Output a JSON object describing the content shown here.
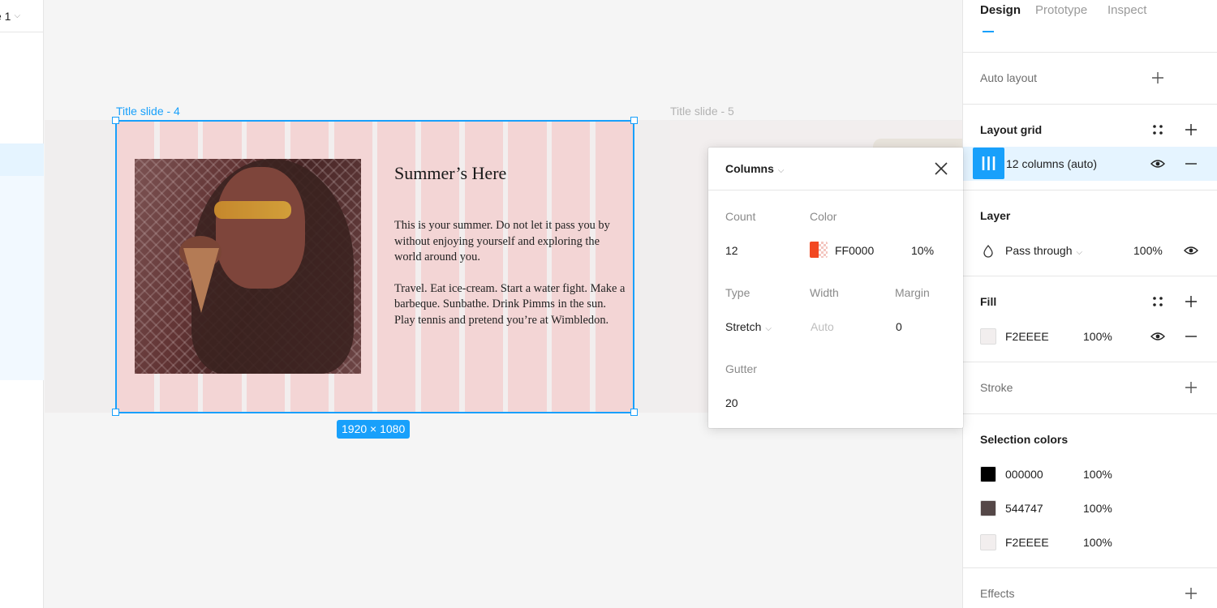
{
  "left_panel": {
    "page_label": "e 1"
  },
  "canvas": {
    "frame_active_label": "Title slide - 4",
    "frame_inactive_label": "Title slide - 5",
    "size_badge": "1920 × 1080",
    "slide": {
      "title": "Summer’s Here",
      "paragraph1": "This is your summer. Do not let it pass you by without enjoying yourself and exploring the world around you.",
      "paragraph2": "Travel. Eat ice-cream. Start a water fight. Make a barbeque. Sunbathe. Drink Pimms in the sun. Play tennis and pretend you’re at Wimbledon."
    }
  },
  "popover": {
    "title": "Columns",
    "count_label": "Count",
    "count_value": "12",
    "color_label": "Color",
    "color_hex": "FF0000",
    "color_opacity": "10%",
    "type_label": "Type",
    "type_value": "Stretch",
    "width_label": "Width",
    "width_value": "Auto",
    "margin_label": "Margin",
    "margin_value": "0",
    "gutter_label": "Gutter",
    "gutter_value": "20"
  },
  "right_panel": {
    "tabs": [
      "Design",
      "Prototype",
      "Inspect"
    ],
    "auto_layout": "Auto layout",
    "layout_grid": {
      "title": "Layout grid",
      "item": "12 columns (auto)"
    },
    "layer": {
      "title": "Layer",
      "blend": "Pass through",
      "opacity": "100%"
    },
    "fill": {
      "title": "Fill",
      "hex": "F2EEEE",
      "opacity": "100%"
    },
    "stroke": "Stroke",
    "selection_colors": {
      "title": "Selection colors",
      "items": [
        {
          "hex": "000000",
          "opacity": "100%",
          "color": "#000000"
        },
        {
          "hex": "544747",
          "opacity": "100%",
          "color": "#544747"
        },
        {
          "hex": "F2EEEE",
          "opacity": "100%",
          "color": "#F2EEEE"
        }
      ]
    },
    "effects": "Effects"
  },
  "colors": {
    "accent": "#18a0fb",
    "grid": "#FF0000",
    "fill": "#F2EEEE"
  }
}
